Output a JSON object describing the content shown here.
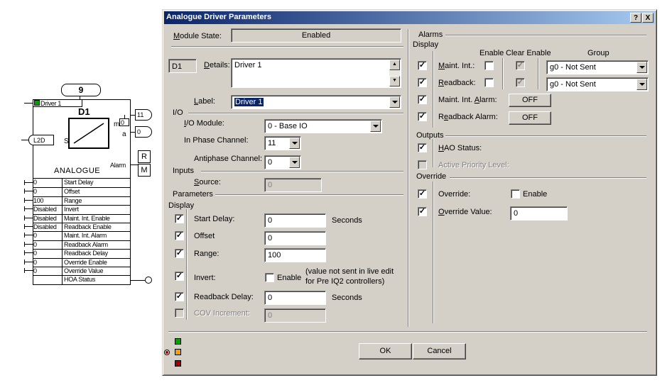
{
  "block": {
    "number": "9",
    "name": "D1",
    "type_label": "ANALOGUE",
    "top_input_label": "Driver 1",
    "input_label": "S",
    "input_source": "L2D",
    "output_m_label": "m",
    "output_a_label": "a",
    "output_m_value": "0",
    "output_value": "11",
    "output_a_value": "0",
    "alarm_label": "Alarm",
    "r_label": "R",
    "m_label": "M",
    "params": [
      {
        "value": "0",
        "name": "Start Delay"
      },
      {
        "value": "0",
        "name": "Offset"
      },
      {
        "value": "100",
        "name": "Range"
      },
      {
        "value": "Disabled",
        "name": "Invert"
      },
      {
        "value": "Disabled",
        "name": "Maint. Int. Enable"
      },
      {
        "value": "Disabled",
        "name": "Readback Enable"
      },
      {
        "value": "0",
        "name": "Maint. Int. Alarm"
      },
      {
        "value": "0",
        "name": "Readback Alarm"
      },
      {
        "value": "0",
        "name": "Readback Delay"
      },
      {
        "value": "0",
        "name": "Override Enable"
      },
      {
        "value": "0",
        "name": "Override Value"
      },
      {
        "value": "",
        "name": "HOA Status"
      }
    ]
  },
  "dialog": {
    "title": "Analogue Driver Parameters",
    "help_btn": "?",
    "close_btn": "X",
    "module_state_label": "Module State:",
    "module_state_value": "Enabled",
    "id": "D1",
    "details_label": "Details:",
    "details_value": "Driver 1",
    "label_label": "Label:",
    "label_value": "Driver 1",
    "io": {
      "title": "I/O",
      "io_module_label": "I/O Module:",
      "io_module_value": "0 - Base IO",
      "in_phase_label": "In Phase Channel:",
      "in_phase_value": "11",
      "antiphase_label": "Antiphase Channel:",
      "antiphase_value": "0"
    },
    "inputs": {
      "title": "Inputs",
      "source_label": "Source:",
      "source_value": "0"
    },
    "parameters": {
      "title": "Parameters",
      "display_label": "Display",
      "start_delay_label": "Start Delay:",
      "start_delay_value": "0",
      "start_delay_unit": "Seconds",
      "offset_label": "Offset",
      "offset_value": "0",
      "range_label": "Range:",
      "range_value": "100",
      "invert_label": "Invert:",
      "invert_enable": "Enable",
      "invert_note_1": "(value not sent in live edit",
      "invert_note_2": "for Pre IQ2 controllers)",
      "readback_delay_label": "Readback Delay:",
      "readback_delay_value": "0",
      "readback_delay_unit": "Seconds",
      "cov_label": "COV Increment:",
      "cov_value": "0"
    },
    "alarms": {
      "title": "Alarms",
      "display_label": "Display",
      "col_enable": "Enable",
      "col_clear_enable": "Clear Enable",
      "col_group": "Group",
      "maint_int_label": "Maint. Int.:",
      "maint_group": "g0  - Not Sent",
      "readback_label": "Readback:",
      "readback_group": "g0  - Not Sent",
      "maint_alarm_label": "Maint. Int. Alarm:",
      "maint_alarm_btn": "OFF",
      "readback_alarm_label": "Readback Alarm:",
      "readback_alarm_btn": "OFF"
    },
    "outputs": {
      "title": "Outputs",
      "hao_label": "HAO Status:",
      "active_priority_label": "Active Priority Level:"
    },
    "override": {
      "title": "Override",
      "override_label": "Override:",
      "override_enable": "Enable",
      "override_value_label": "Override Value:",
      "override_value": "0"
    },
    "ok_label": "OK",
    "cancel_label": "Cancel",
    "check_mark": "✓"
  },
  "colors": {
    "title_start": "#0a246a",
    "title_end": "#a6caf0",
    "face": "#d4d0c8",
    "led_green": "#00a000",
    "led_orange": "#f0a000",
    "led_red": "#a00000"
  }
}
